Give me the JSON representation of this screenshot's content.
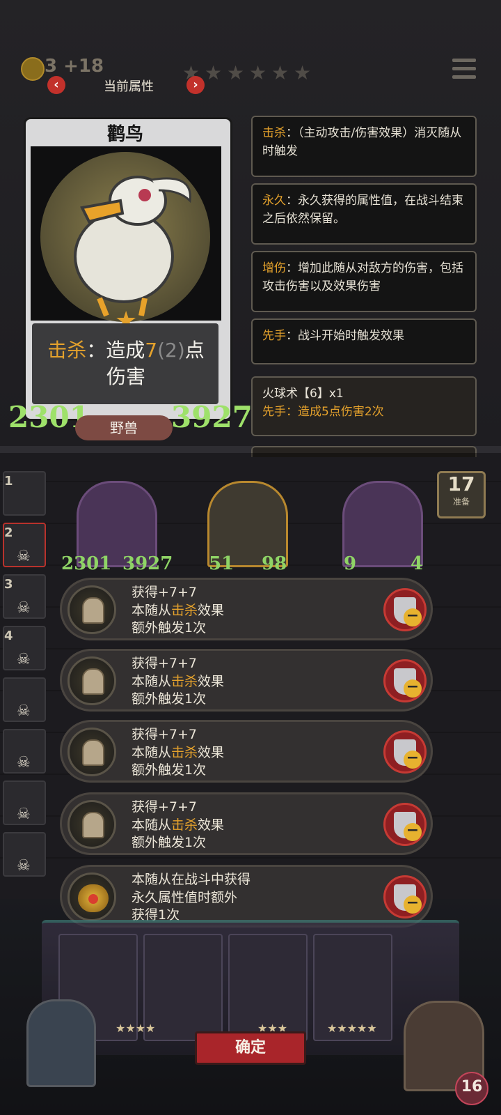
{
  "top_bar": {
    "coins": "3 +18",
    "title": "当前属性",
    "prev_label": "‹",
    "next_label": "›"
  },
  "card": {
    "name": "鹳鸟",
    "desc_keyword": "击杀",
    "desc_sep": "：",
    "desc_part1": "造成",
    "desc_value": "7",
    "desc_base": "(2)",
    "desc_part2": "点伤害",
    "attack": "2301",
    "health": "3927",
    "race": "野兽"
  },
  "keywords": [
    {
      "keyword": "击杀",
      "text": "：（主动攻击/伤害效果）消灭随从时触发"
    },
    {
      "keyword": "永久",
      "text": "：永久获得的属性值，在战斗结束之后依然保留。"
    },
    {
      "keyword": "增伤",
      "text": "：增加此随从对敌方的伤害，包括攻击伤害以及效果伤害"
    },
    {
      "keyword": "先手",
      "text": "：战斗开始时触发效果"
    }
  ],
  "spell": {
    "title": "火球术【6】x1",
    "line": "先手：造成5点伤害2次"
  },
  "turn": {
    "number": "17",
    "label": "准备"
  },
  "slots": [
    "1",
    "2",
    "3",
    "4"
  ],
  "mini_stats": {
    "unit1_atk": "2301",
    "unit1_hp": "3927",
    "unit2_atk": "51",
    "unit2_hp": "98",
    "unit3_atk": "9",
    "unit3_hp": "4"
  },
  "effects": [
    {
      "icon": "bell-icon",
      "line1": "获得+7+7",
      "line2_pre": "本随从",
      "line2_kw": "击杀",
      "line2_post": "效果",
      "line3": "额外触发1次"
    },
    {
      "icon": "bell-icon",
      "line1": "获得+7+7",
      "line2_pre": "本随从",
      "line2_kw": "击杀",
      "line2_post": "效果",
      "line3": "额外触发1次"
    },
    {
      "icon": "bell-icon",
      "line1": "获得+7+7",
      "line2_pre": "本随从",
      "line2_kw": "击杀",
      "line2_post": "效果",
      "line3": "额外触发1次"
    },
    {
      "icon": "bell-icon",
      "line1": "获得+7+7",
      "line2_pre": "本随从",
      "line2_kw": "击杀",
      "line2_post": "效果",
      "line3": "额外触发1次"
    },
    {
      "icon": "crown-icon",
      "line1": "本随从在战斗中获得",
      "line2_pre": "永久属性值时额外",
      "line2_kw": "",
      "line2_post": "",
      "line3": "获得1次"
    }
  ],
  "bottom": {
    "confirm_label": "确定",
    "hero_hp": "16"
  },
  "colors": {
    "keyword": "#e5a22c",
    "stat_green": "#9ee16a",
    "confirm": "#a9252a"
  }
}
